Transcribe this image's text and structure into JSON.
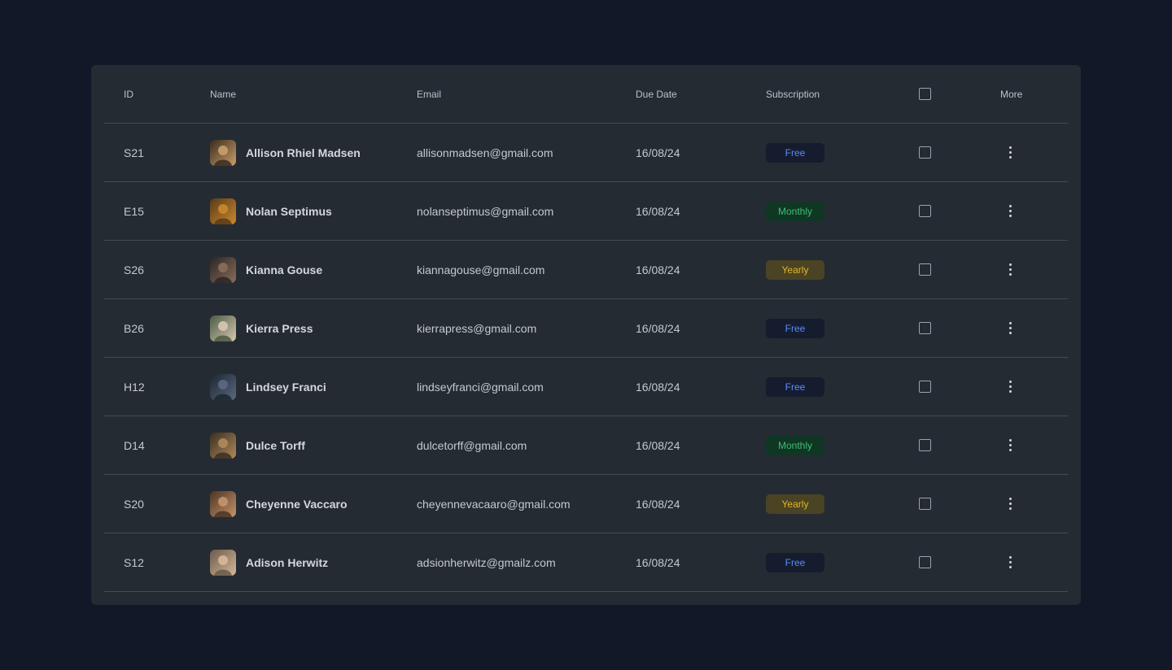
{
  "header": {
    "id": "ID",
    "name": "Name",
    "email": "Email",
    "due_date": "Due Date",
    "subscription": "Subscription",
    "more": "More"
  },
  "badge_styles": {
    "Free": {
      "bg": "#141c2e",
      "fg": "#5a8cff"
    },
    "Monthly": {
      "bg": "#103624",
      "fg": "#3fbf73"
    },
    "Yearly": {
      "bg": "#4a4424",
      "fg": "#e3b628"
    }
  },
  "rows": [
    {
      "id": "S21",
      "name": "Allison Rhiel Madsen",
      "email": "allisonmadsen@gmail.com",
      "due": "16/08/24",
      "subscription": "Free",
      "avatar_colors": [
        "#caa06a",
        "#3a2a1e"
      ]
    },
    {
      "id": "E15",
      "name": "Nolan Septimus",
      "email": "nolanseptimus@gmail.com",
      "due": "16/08/24",
      "subscription": "Monthly",
      "avatar_colors": [
        "#c98a2e",
        "#5a3a18"
      ]
    },
    {
      "id": "S26",
      "name": "Kianna Gouse",
      "email": "kiannagouse@gmail.com",
      "due": "16/08/24",
      "subscription": "Yearly",
      "avatar_colors": [
        "#8a6e5a",
        "#2a2424"
      ]
    },
    {
      "id": "B26",
      "name": "Kierra Press",
      "email": "kierrapress@gmail.com",
      "due": "16/08/24",
      "subscription": "Free",
      "avatar_colors": [
        "#d8c8b0",
        "#4a5a44"
      ]
    },
    {
      "id": "H12",
      "name": "Lindsey Franci",
      "email": "lindseyfranci@gmail.com",
      "due": "16/08/24",
      "subscription": "Free",
      "avatar_colors": [
        "#5a6a80",
        "#1c2430"
      ]
    },
    {
      "id": "D14",
      "name": "Dulce Torff",
      "email": "dulcetorff@gmail.com",
      "due": "16/08/24",
      "subscription": "Monthly",
      "avatar_colors": [
        "#b08a5a",
        "#3a2e22"
      ]
    },
    {
      "id": "S20",
      "name": "Cheyenne Vaccaro",
      "email": "cheyennevacaaro@gmail.com",
      "due": "16/08/24",
      "subscription": "Yearly",
      "avatar_colors": [
        "#c8946a",
        "#4a3424"
      ]
    },
    {
      "id": "S12",
      "name": "Adison Herwitz",
      "email": "adsionherwitz@gmailz.com",
      "due": "16/08/24",
      "subscription": "Free",
      "avatar_colors": [
        "#d8b89a",
        "#6a5a4a"
      ]
    }
  ]
}
